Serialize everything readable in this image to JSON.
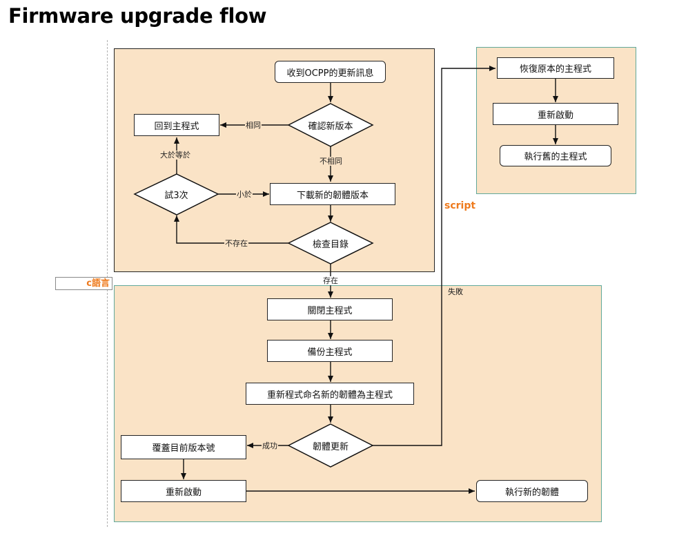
{
  "title": "Firmware upgrade flow",
  "regions": {
    "c_language": "c語言",
    "script": "script"
  },
  "nodes": {
    "receive_ocpp": "收到OCPP的更新訊息",
    "confirm_version": "確認新版本",
    "return_main": "回到主程式",
    "try_three": "試3次",
    "download_fw": "下載新的韌體版本",
    "check_dir": "檢查目錄",
    "close_main": "關閉主程式",
    "backup_main": "備份主程式",
    "rename_fw": "重新程式命名新的韌體為主程式",
    "fw_update": "韌體更新",
    "overwrite_version": "覆蓋目前版本號",
    "reboot_bottom": "重新啟動",
    "run_new_fw": "執行新的韌體",
    "restore_main": "恢復原本的主程式",
    "reboot_right": "重新啟動",
    "run_old_main": "執行舊的主程式"
  },
  "edges": {
    "same": "相同",
    "not_same": "不相同",
    "greater_equal": "大於等於",
    "less_than": "小於",
    "not_exist": "不存在",
    "exist": "存在",
    "success": "成功",
    "fail": "失敗"
  }
}
